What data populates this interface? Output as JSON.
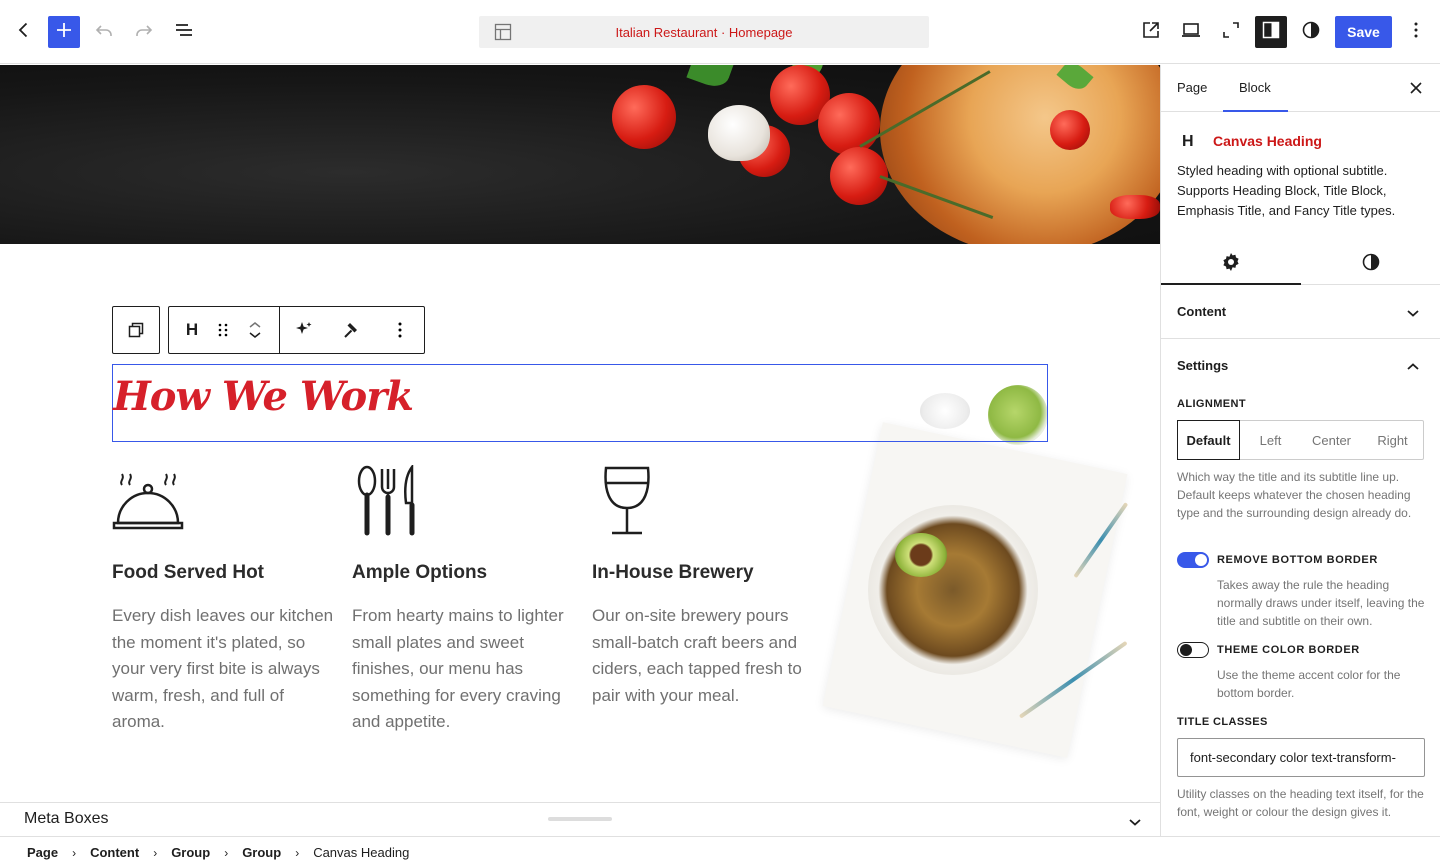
{
  "editor": {
    "document_title": "Italian Restaurant · Homepage",
    "save_label": "Save"
  },
  "icons": {
    "back": "chevron-left-icon",
    "add": "plus-icon",
    "undo": "undo-icon",
    "redo": "redo-icon",
    "list_view": "list-view-icon",
    "template": "layout-icon",
    "view_external": "external-link-icon",
    "device_preview": "laptop-icon",
    "fullscreen": "fullscreen-icon",
    "sidebar": "sidebar-icon",
    "styles": "contrast-icon",
    "options": "more-vertical-icon"
  },
  "colors": {
    "accent": "#3858e9",
    "brand_red": "#cc1818",
    "heading_red": "#d6202a"
  },
  "canvas": {
    "heading": "How We Work",
    "columns": [
      {
        "icon": "serving-cloche-icon",
        "title": "Food Served Hot",
        "text": "Every dish leaves our kitchen the moment it's plated, so your very first bite is always warm, fresh, and full of aroma."
      },
      {
        "icon": "cutlery-icon",
        "title": "Ample Options",
        "text": "From hearty mains to lighter small plates and sweet finishes, our menu has something for every craving and appetite."
      },
      {
        "icon": "wine-glass-icon",
        "title": "In-House Brewery",
        "text": "Our on-site brewery pours small-batch craft beers and ciders, each tapped fresh to pair with your meal."
      }
    ],
    "block_toolbar": {
      "heading_letter": "H"
    }
  },
  "metabox": {
    "title": "Meta Boxes"
  },
  "breadcrumbs": [
    "Page",
    "Content",
    "Group",
    "Group"
  ],
  "breadcrumb_current": "Canvas Heading",
  "sidebar": {
    "tabs": [
      "Page",
      "Block"
    ],
    "active_tab": "Block",
    "block_letter": "H",
    "block_name": "Canvas Heading",
    "block_description": "Styled heading with optional subtitle. Supports Heading Block, Title Block, Emphasis Title, and Fancy Title types.",
    "panels": {
      "content": "Content",
      "settings": "Settings"
    },
    "alignment": {
      "label": "Alignment",
      "options": [
        "Default",
        "Left",
        "Center",
        "Right"
      ],
      "selected": "Default",
      "help": "Which way the title and its subtitle line up. Default keeps whatever the chosen heading type and the surrounding design already do."
    },
    "remove_bottom_border": {
      "label": "Remove bottom border",
      "checked": true,
      "help": "Takes away the rule the heading normally draws under itself, leaving the title and subtitle on their own."
    },
    "theme_color_border": {
      "label": "Theme color border",
      "checked": false,
      "help": "Use the theme accent color for the bottom border."
    },
    "title_classes": {
      "label": "Title classes",
      "value": "font-secondary color text-transform-",
      "help": "Utility classes on the heading text itself, for the font, weight or colour the design gives it."
    }
  }
}
